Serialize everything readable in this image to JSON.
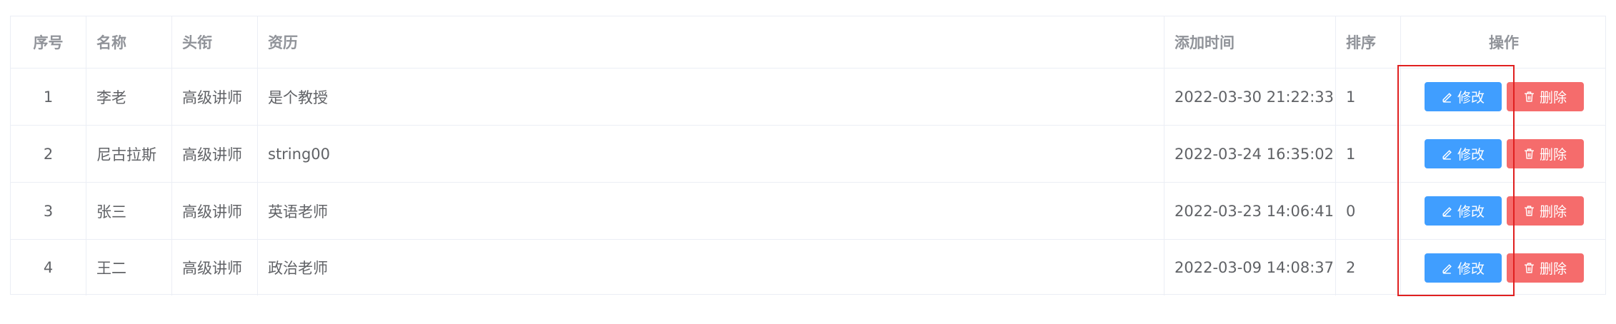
{
  "table": {
    "columns": [
      "序号",
      "名称",
      "头衔",
      "资历",
      "添加时间",
      "排序",
      "操作"
    ],
    "rows": [
      {
        "index": "1",
        "name": "李老",
        "title": "高级讲师",
        "bio": "是个教授",
        "added": "2022-03-30 21:22:33",
        "sort": "1"
      },
      {
        "index": "2",
        "name": "尼古拉斯",
        "title": "高级讲师",
        "bio": "string00",
        "added": "2022-03-24 16:35:02",
        "sort": "1"
      },
      {
        "index": "3",
        "name": "张三",
        "title": "高级讲师",
        "bio": "英语老师",
        "added": "2022-03-23 14:06:41",
        "sort": "0"
      },
      {
        "index": "4",
        "name": "王二",
        "title": "高级讲师",
        "bio": "政治老师",
        "added": "2022-03-09 14:08:37",
        "sort": "2"
      }
    ]
  },
  "actions": {
    "edit_label": "修改",
    "edit_icon": "edit-icon",
    "delete_label": "删除",
    "delete_icon": "trash-icon"
  },
  "colors": {
    "edit_button": "#409eff",
    "delete_button": "#f56c6c",
    "highlight_box": "#e02020"
  }
}
